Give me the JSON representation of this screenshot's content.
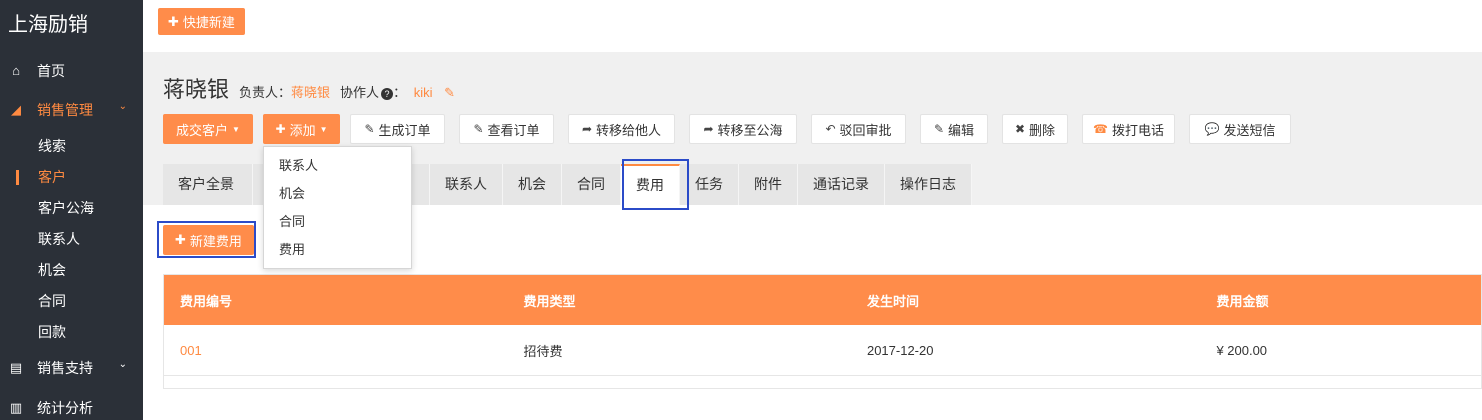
{
  "brand": "上海励销",
  "sidebar": {
    "items": [
      {
        "icon": "home-icon",
        "glyph": "⌂",
        "label": "首页"
      },
      {
        "icon": "chart-area-icon",
        "glyph": "◢",
        "label": "销售管理",
        "caret": "⌄"
      }
    ],
    "sub_items": [
      "线索",
      "客户",
      "客户公海",
      "联系人",
      "机会",
      "合同",
      "回款"
    ],
    "bottom_items": [
      {
        "icon": "file-icon",
        "glyph": "▤",
        "label": "销售支持",
        "caret": "⌄"
      },
      {
        "icon": "bar-chart-icon",
        "glyph": "▥",
        "label": "统计分析"
      }
    ]
  },
  "topbar": {
    "quick_new": "快捷新建"
  },
  "customer": {
    "name": "蒋晓银",
    "owner_label": "负责人：",
    "owner": "蒋晓银",
    "collab_label": "协作人",
    "collab_suffix": "：",
    "collaborator": "kiki"
  },
  "actions": [
    {
      "label": "成交客户",
      "glyph": ""
    },
    {
      "label": "添加",
      "glyph": "✚"
    },
    {
      "label": "生成订单",
      "glyph": "✎"
    },
    {
      "label": "查看订单",
      "glyph": "✎"
    },
    {
      "label": "转移给他人",
      "glyph": "➦"
    },
    {
      "label": "转移至公海",
      "glyph": "➦"
    },
    {
      "label": "驳回审批",
      "glyph": "↶"
    },
    {
      "label": "编辑",
      "glyph": "✎"
    },
    {
      "label": "删除",
      "glyph": "✖"
    },
    {
      "label": "拨打电话",
      "glyph": "☎"
    },
    {
      "label": "发送短信",
      "glyph": "💬"
    }
  ],
  "add_menu": [
    "联系人",
    "机会",
    "合同",
    "费用"
  ],
  "tabs": [
    "客户全景",
    "",
    "",
    "",
    "联系人",
    "机会",
    "合同",
    "费用",
    "任务",
    "附件",
    "通话记录",
    "操作日志"
  ],
  "tabs_visible": [
    "客户全景",
    "联系人",
    "机会",
    "合同",
    "费用",
    "任务",
    "附件",
    "通话记录",
    "操作日志"
  ],
  "new_fee": "新建费用",
  "table": {
    "headers": [
      "费用编号",
      "费用类型",
      "发生时间",
      "费用金额"
    ],
    "rows": [
      [
        "001",
        "招待费",
        "2017-12-20",
        "¥ 200.00"
      ]
    ]
  },
  "colors": {
    "accent": "#ff8c4a",
    "sidebar_bg": "#2b3038",
    "highlight": "#2b4bc8"
  }
}
